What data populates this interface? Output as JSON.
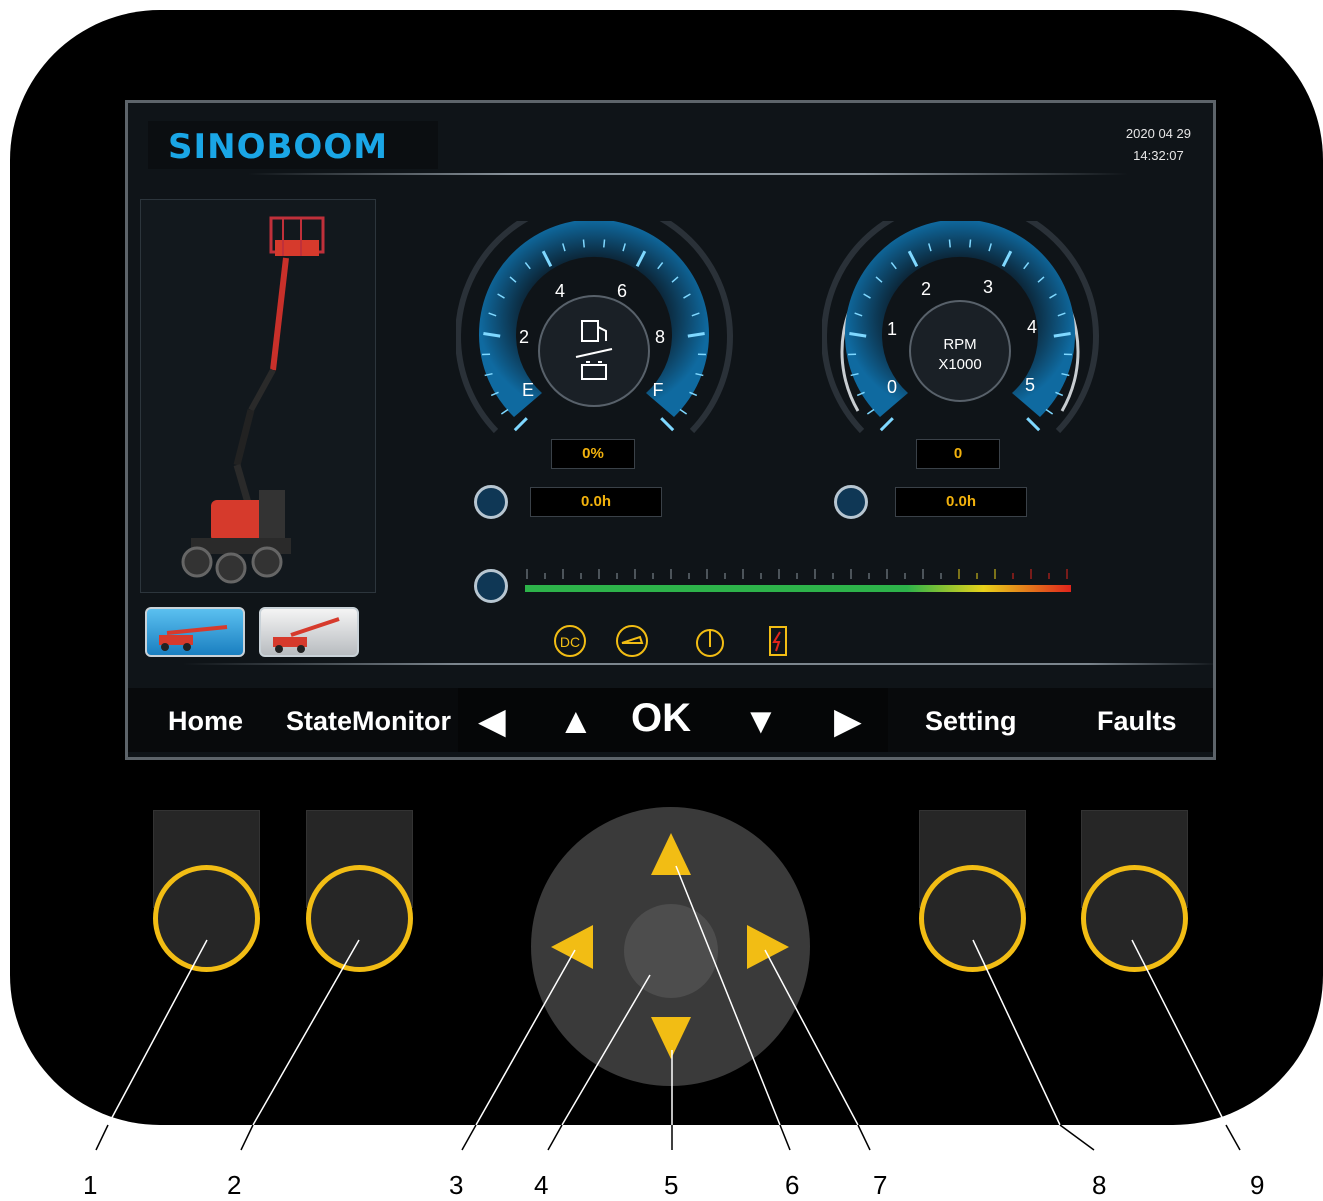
{
  "brand": {
    "name": "SINOBOOM"
  },
  "datetime": {
    "date": "2020 04 29",
    "time": "14:32:07"
  },
  "fuel_gauge": {
    "ticks": [
      "E",
      "2",
      "4",
      "6",
      "8",
      "F"
    ],
    "level_text": "0%",
    "hours_text": "0.0h",
    "icons": [
      "fuel-pump-icon",
      "battery-icon"
    ]
  },
  "rpm_gauge": {
    "ticks": [
      "0",
      "1",
      "2",
      "3",
      "4",
      "5"
    ],
    "center_line1": "RPM",
    "center_line2": "X1000",
    "value_text": "0",
    "hours_text": "0.0h"
  },
  "load_bar": {
    "icon": "load-weight-icon",
    "colors": [
      "#2db34a",
      "#e8d21a",
      "#e0241c"
    ]
  },
  "status_icons": [
    "dc-icon",
    "engine-oil-icon",
    "water-temp-icon",
    "battery-charge-icon"
  ],
  "nav": {
    "home": "Home",
    "state_monitor": "StateMonitor",
    "left": "◀",
    "up": "▲",
    "ok": "OK",
    "down": "▼",
    "right": "▶",
    "setting": "Setting",
    "faults": "Faults"
  },
  "callouts": [
    "1",
    "2",
    "3",
    "4",
    "5",
    "6",
    "7",
    "8",
    "9"
  ],
  "colors": {
    "accent_yellow": "#f2bd14",
    "brand_blue": "#1aa6e6",
    "gauge_blue": "#1e9fe0"
  }
}
